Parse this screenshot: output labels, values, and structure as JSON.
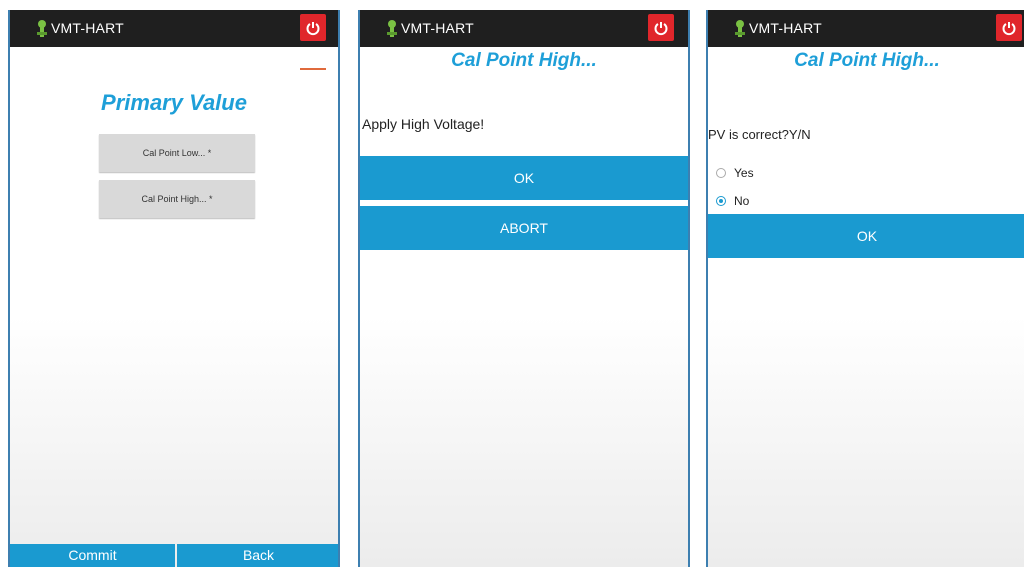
{
  "app": {
    "title": "VMT-HART"
  },
  "icons": {
    "logo": "key-person-icon",
    "power": "power-icon"
  },
  "colors": {
    "accent": "#1a9ad0",
    "title": "#1e9fd8",
    "power": "#e0262b",
    "appbar": "#1f1f1f"
  },
  "screen1": {
    "title": "Primary Value",
    "menu": [
      "Cal Point Low... *",
      "Cal Point High... *"
    ],
    "commit_label": "Commit",
    "back_label": "Back"
  },
  "screen2": {
    "title": "Cal Point High...",
    "prompt": "Apply High Voltage!",
    "ok_label": "OK",
    "abort_label": "ABORT"
  },
  "screen3": {
    "title": "Cal Point High...",
    "prompt": "PV is correct?Y/N",
    "options": [
      {
        "label": "Yes",
        "checked": false
      },
      {
        "label": "No",
        "checked": true
      }
    ],
    "ok_label": "OK"
  }
}
